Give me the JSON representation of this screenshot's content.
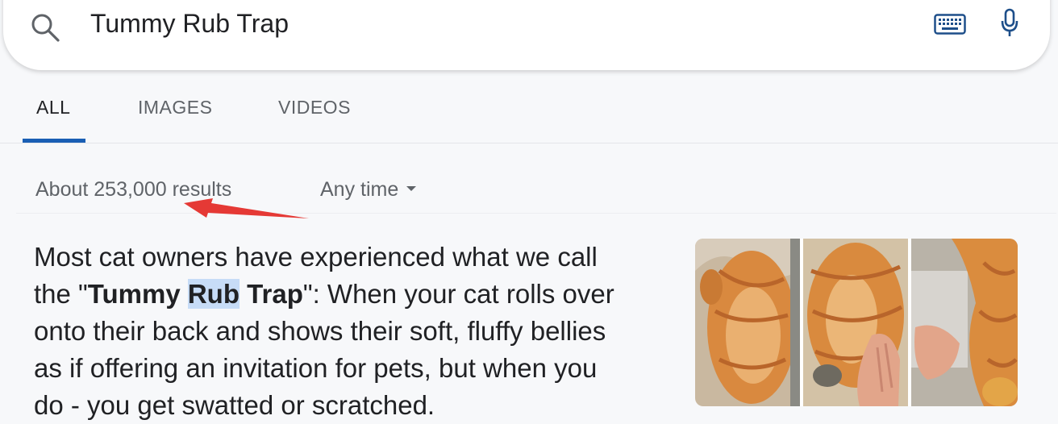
{
  "search": {
    "query": "Tummy Rub Trap",
    "icons": [
      "search-icon",
      "keyboard-icon",
      "microphone-icon"
    ]
  },
  "tabs": [
    {
      "label": "ALL",
      "active": true
    },
    {
      "label": "IMAGES",
      "active": false
    },
    {
      "label": "VIDEOS",
      "active": false
    }
  ],
  "results_bar": {
    "count_text": "About 253,000 results",
    "time_filter": "Any time"
  },
  "snippet": {
    "line1": "Most cat owners have experienced what we call",
    "line2_prefix": "the \"",
    "bold_1": "Tummy",
    "bold_2": "Rub",
    "bold_3": "Trap",
    "line2_suffix": "\": When your cat rolls over",
    "line3": "onto their back and shows their soft, fluffy bellies",
    "line4": "as if offering an invitation for pets, but when you",
    "line5": "do - you get swatted or scratched."
  },
  "colors": {
    "accent": "#1a5fb4",
    "highlight": "#c7dcf7",
    "annotation_arrow": "#e53935"
  },
  "images": [
    "cat-photo-1",
    "cat-photo-2",
    "cat-photo-3"
  ]
}
